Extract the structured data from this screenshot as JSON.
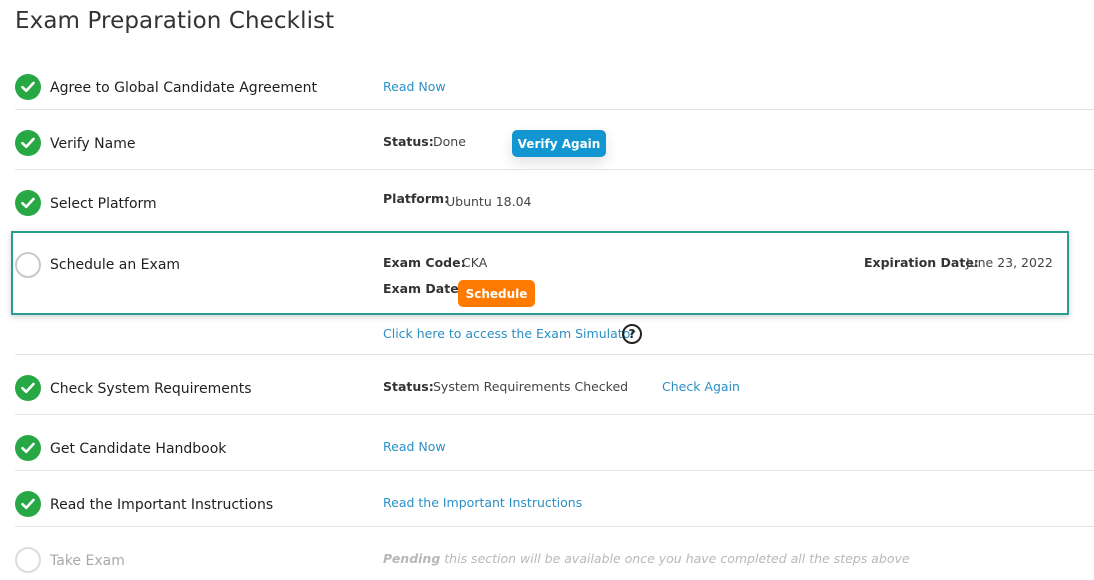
{
  "page": {
    "title": "Exam Preparation Checklist"
  },
  "steps": [
    {
      "label": "Agree to Global Candidate Agreement",
      "status": "complete",
      "link": "Read Now"
    },
    {
      "label": "Verify Name",
      "status": "complete",
      "field_label": "Status:",
      "field_value": "Done",
      "button": "Verify Again"
    },
    {
      "label": "Select Platform",
      "status": "complete",
      "field_label": "Platform:",
      "field_value": "Ubuntu 18.04"
    },
    {
      "label": "Schedule an Exam",
      "status": "incomplete",
      "exam_code_label": "Exam Code:",
      "exam_code_value": "CKA",
      "exam_date_label": "Exam Date:",
      "button": "Schedule",
      "expiration_label": "Expiration Date:",
      "expiration_value": "June 23, 2022",
      "simulator_link": "Click here to access the Exam Simulator",
      "help_glyph": "?"
    },
    {
      "label": "Check System Requirements",
      "status": "complete",
      "field_label": "Status:",
      "field_value": "System Requirements Checked",
      "link": "Check Again"
    },
    {
      "label": "Get Candidate Handbook",
      "status": "complete",
      "link": "Read Now"
    },
    {
      "label": "Read the Important Instructions",
      "status": "complete",
      "link": "Read the Important Instructions"
    },
    {
      "label": "Take Exam",
      "status": "pending",
      "pending_word": "Pending",
      "pending_text": " this section will be available once you have completed all the steps above"
    }
  ],
  "colors": {
    "complete": "#28a745",
    "link": "#2b8fc4",
    "verify_button": "#1296d1",
    "schedule_button": "#ff7a00",
    "highlight_border": "#2a9d8f"
  },
  "icons": {
    "complete": "check-circle-icon",
    "incomplete": "empty-circle-icon",
    "help": "question-circle-icon"
  }
}
